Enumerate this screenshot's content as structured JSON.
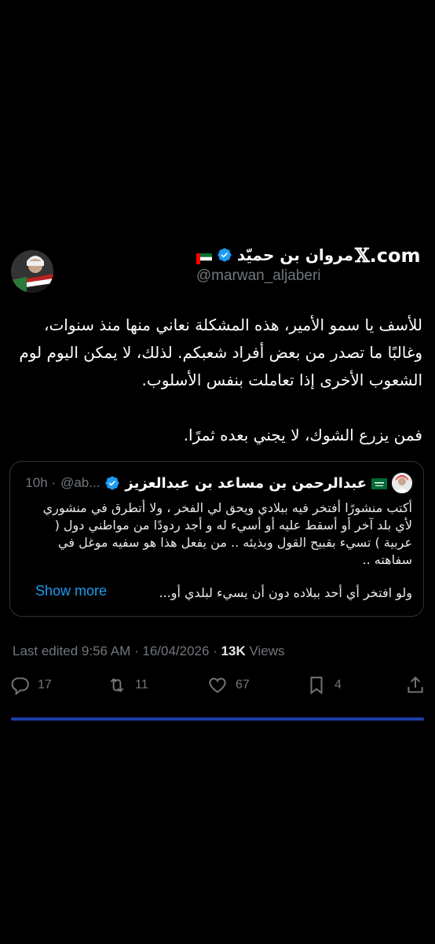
{
  "brand": {
    "logo_text": ".com",
    "logo_glyph": "𝕏"
  },
  "author": {
    "name": "مروان بن حميّد",
    "handle": "@marwan_aljaberi",
    "verified": true,
    "flag": "UAE"
  },
  "tweet": {
    "paragraphs": [
      "للأسف يا سمو الأمير، هذه المشكلة نعاني منها منذ سنوات، وغالبًا ما تصدر من بعض أفراد شعبكم. لذلك، لا يمكن اليوم لوم الشعوب الأخرى إذا تعاملت بنفس الأسلوب.",
      "فمن يزرع الشوك، لا يجني بعده ثمرًا."
    ]
  },
  "quoted": {
    "name": "عبدالرحمن بن مساعد بن عبدالعزيز",
    "handle": "@ab...",
    "time": "10h",
    "flag": "Saudi",
    "text": "أكتب منشورًا أفتخر فيه ببلادي ويحق لي الفخر ، ولا أتطرق في منشوري لأي بلد آخر أو أسقط عليه أو أسيء له و أجد ردودًا من مواطني دول ( عربية ) تسيء بقبيح القول وبذيئه .. من يفعل هذا هو سفيه موغل في سفاهته ..",
    "last_line": "ولو افتخر أي أحد ببلاده دون أن يسيء لبلدي أو...",
    "show_more": "Show more"
  },
  "meta": {
    "edited": "Last edited 9:56 AM · 16/04/2026 · ",
    "views_count": "13K",
    "views_label": " Views"
  },
  "actions": {
    "replies": "17",
    "retweets": "11",
    "likes": "67",
    "bookmarks": "4"
  },
  "colors": {
    "accent": "#1d9bf0",
    "verified": "#1d9bf0",
    "muted": "#71767b"
  },
  "progress": 1.0
}
